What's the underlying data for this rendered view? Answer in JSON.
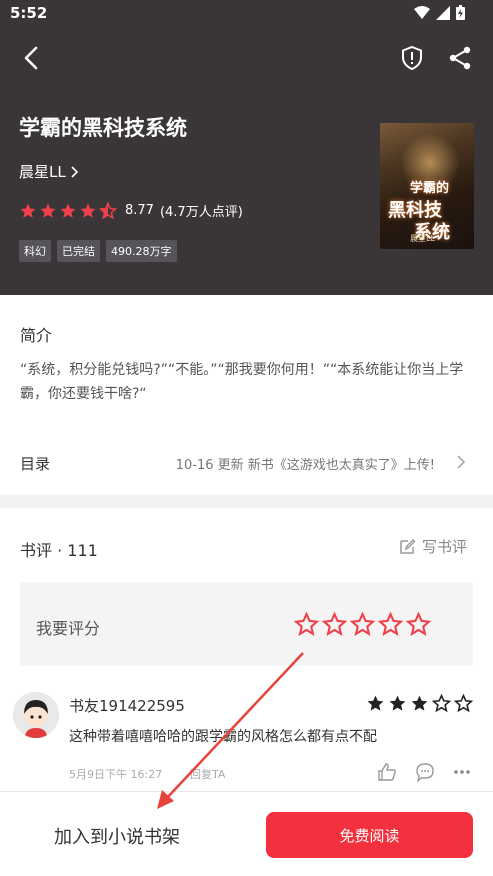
{
  "status_bar": {
    "time": "5:52"
  },
  "book": {
    "title": "学霸的黑科技系统",
    "author": "晨星LL",
    "score": "8.77",
    "rating_count": "(4.7万人点评)",
    "rating_stars": 4.5,
    "tags": [
      "科幻",
      "已完结",
      "490.28万字"
    ],
    "cover": {
      "title_line1": "学霸的",
      "title_line2": "黑科技",
      "title_line3": "系统",
      "author": "晨星LL"
    }
  },
  "intro": {
    "heading": "简介",
    "text": "“系统，积分能兑钱吗?”“不能。”“那我要你何用！”“本系统能让你当上学霸，你还要钱干啥?“"
  },
  "toc": {
    "label": "目录",
    "latest": "10-16  更新  新书《这游戏也太真实了》上传!"
  },
  "reviews": {
    "heading": "书评 · 111",
    "write_label": "写书评",
    "rate_label": "我要评分",
    "rate_stars": 5,
    "items": [
      {
        "user": "书友191422595",
        "stars": 3,
        "text": "这种带着嘻嘻哈哈的跟学霸的风格怎么都有点不配",
        "date": "5月9日下午 16:27",
        "reply": "回复TA"
      }
    ]
  },
  "bottom": {
    "add_shelf": "加入到小说书架",
    "read_button": "免费阅读"
  },
  "colors": {
    "header_bg": "#3a3638",
    "accent_red": "#f3303e",
    "star_red": "#f04049",
    "arrow": "#e8433a"
  }
}
